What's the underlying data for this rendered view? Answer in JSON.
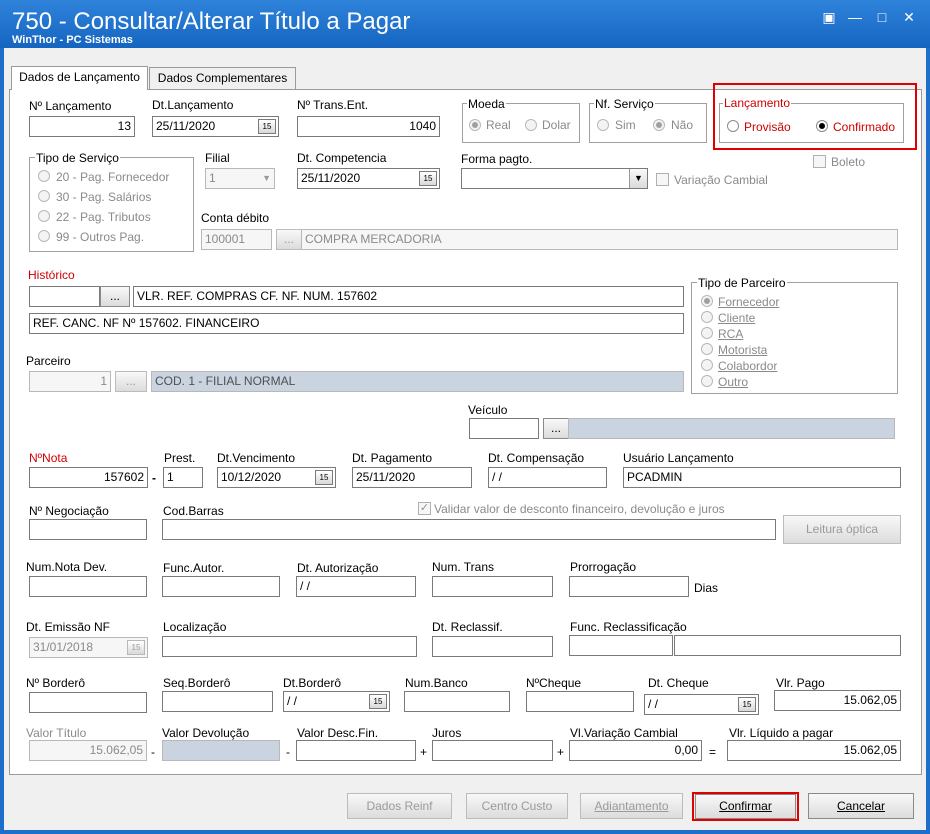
{
  "window": {
    "title": "750 - Consultar/Alterar Título a Pagar",
    "subtitle": "WinThor - PC Sistemas",
    "controls": [
      "pin-icon",
      "minimize-icon",
      "maximize-icon",
      "close-icon"
    ]
  },
  "tabs": [
    "Dados de Lançamento",
    "Dados Complementares"
  ],
  "num_lancamento": {
    "label": "Nº Lançamento",
    "value": "13"
  },
  "dt_lancamento": {
    "label": "Dt.Lançamento",
    "value": "25/11/2020"
  },
  "num_trans_ent": {
    "label": "Nº Trans.Ent.",
    "value": "1040"
  },
  "moeda": {
    "label": "Moeda",
    "options": [
      "Real",
      "Dolar"
    ]
  },
  "nf_servico": {
    "label": "Nf. Serviço",
    "options": [
      "Sim",
      "Não"
    ]
  },
  "lancamento": {
    "label": "Lançamento",
    "options": [
      "Provisão",
      "Confirmado"
    ],
    "color": "#d00000"
  },
  "tipo_servico": {
    "label": "Tipo de Serviço",
    "options": [
      "20 - Pag. Fornecedor",
      "30 - Pag. Salários",
      "22 - Pag. Tributos",
      "99 - Outros Pag."
    ]
  },
  "filial": {
    "label": "Filial",
    "value": "1"
  },
  "dt_competencia": {
    "label": "Dt. Competencia",
    "value": "25/11/2020"
  },
  "forma_pagto": {
    "label": "Forma pagto.",
    "value": ""
  },
  "variacao_cambial": "Variação Cambial",
  "boleto": "Boleto",
  "conta_debito": {
    "label": "Conta débito",
    "code": "100001",
    "btn": "...",
    "description": "COMPRA MERCADORIA"
  },
  "historico": {
    "label": "Histórico",
    "btn": "...",
    "line1": "VLR. REF. COMPRAS CF. NF. NUM. 157602",
    "line2": "REF. CANC. NF Nº 157602. FINANCEIRO"
  },
  "tipo_parceiro": {
    "label": "Tipo de Parceiro",
    "options": [
      "Fornecedor",
      "Cliente",
      "RCA",
      "Motorista",
      "Colabordor",
      "Outro"
    ]
  },
  "parceiro": {
    "label": "Parceiro",
    "code": "1",
    "btn": "...",
    "description": "COD. 1 - FILIAL NORMAL"
  },
  "veiculo": {
    "label": "Veículo",
    "btn": "..."
  },
  "nota": {
    "label": "NºNota",
    "value": "157602",
    "sep": "-"
  },
  "prest": {
    "label": "Prest.",
    "value": "1"
  },
  "dt_vencimento": {
    "label": "Dt.Vencimento",
    "value": "10/12/2020"
  },
  "dt_pagamento": {
    "label": "Dt. Pagamento",
    "value": "25/11/2020"
  },
  "dt_compensacao": {
    "label": "Dt. Compensação",
    "value": " / /"
  },
  "usuario_lancamento": {
    "label": "Usuário Lançamento",
    "value": "PCADMIN"
  },
  "num_negociacao": {
    "label": "Nº Negociação"
  },
  "cod_barras": {
    "label": "Cod.Barras"
  },
  "validar_desconto": "Validar valor de desconto financeiro,  devolução e juros",
  "leitura_optica": "Leitura óptica",
  "num_nota_dev": {
    "label": "Num.Nota Dev."
  },
  "func_autor": {
    "label": "Func.Autor."
  },
  "dt_autorizacao": {
    "label": "Dt. Autorização",
    "value": " / /"
  },
  "num_trans": {
    "label": "Num. Trans"
  },
  "prorrogacao": {
    "label": "Prorrogação",
    "unit": "Dias"
  },
  "dt_emissao_nf": {
    "label": "Dt. Emissão NF",
    "value": "31/01/2018"
  },
  "localizacao": {
    "label": "Localização"
  },
  "dt_reclassif": {
    "label": "Dt. Reclassif."
  },
  "func_reclassificacao": {
    "label": "Func. Reclassificação"
  },
  "num_bordero": {
    "label": "Nº Borderô"
  },
  "seq_bordero": {
    "label": "Seq.Borderô"
  },
  "dt_bordero": {
    "label": "Dt.Borderô",
    "value": " / /"
  },
  "num_banco": {
    "label": "Num.Banco"
  },
  "num_cheque": {
    "label": "NºCheque"
  },
  "dt_cheque": {
    "label": "Dt. Cheque",
    "value": " / /"
  },
  "vlr_pago": {
    "label": "Vlr. Pago",
    "value": "15.062,05"
  },
  "valor_titulo": {
    "label": "Valor Título",
    "value": "15.062,05"
  },
  "valor_devolucao": {
    "label": "Valor Devolução"
  },
  "valor_desc_fin": {
    "label": "Valor Desc.Fin."
  },
  "juros": {
    "label": "Juros"
  },
  "vl_variacao_cambial": {
    "label": "Vl.Variação Cambial",
    "value": "0,00"
  },
  "vlr_liquido": {
    "label": "Vlr. Líquido a pagar",
    "value": "15.062,05"
  },
  "ops": {
    "minus": "-",
    "plus": "+",
    "equals": "="
  },
  "footer": {
    "dados_reinf": "Dados Reinf",
    "centro_custo": "Centro Custo",
    "adiantamento": "Adiantamento",
    "confirmar": "Confirmar",
    "cancelar": "Cancelar"
  },
  "colors": {
    "title_bar": "#1565c0",
    "highlight": "#e00000",
    "disabled_fill": "#c9d4e0"
  }
}
